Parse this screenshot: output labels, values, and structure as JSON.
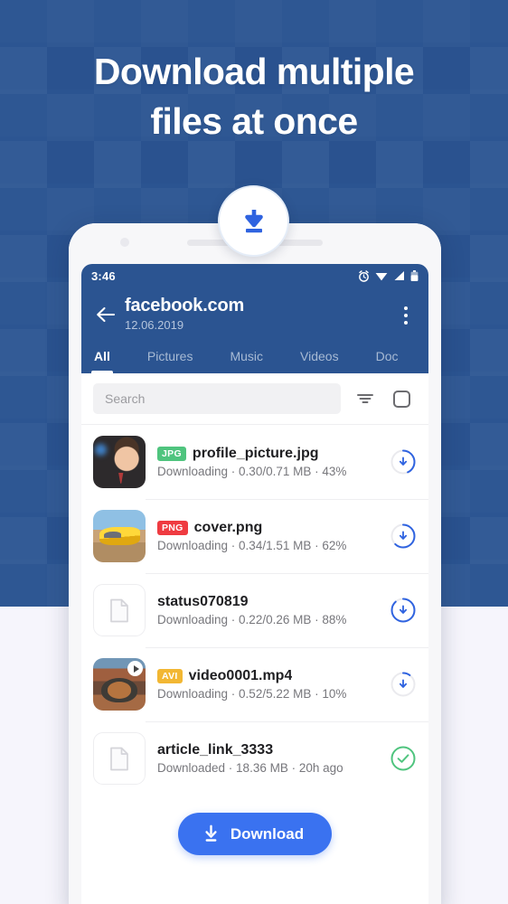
{
  "promo": {
    "headline_line1": "Download multiple",
    "headline_line2": "files at once",
    "medallion_icon": "download-arrow-icon",
    "bg_color": "#2b5491"
  },
  "phone": {
    "statusbar": {
      "time": "3:46",
      "icons": [
        "alarm-icon",
        "wifi-icon",
        "signal-icon",
        "battery-icon"
      ]
    },
    "appbar": {
      "back_icon": "back-arrow-icon",
      "title": "facebook.com",
      "subtitle": "12.06.2019",
      "overflow_icon": "more-vertical-icon"
    },
    "tabs": [
      {
        "label": "All",
        "active": true
      },
      {
        "label": "Pictures",
        "active": false
      },
      {
        "label": "Music",
        "active": false
      },
      {
        "label": "Videos",
        "active": false
      },
      {
        "label": "Doc",
        "active": false
      }
    ],
    "search": {
      "value": "",
      "placeholder": "Search",
      "sort_icon": "sort-filter-icon",
      "select_all_icon": "select-all-checkbox-icon"
    },
    "files": [
      {
        "name": "profile_picture.jpg",
        "badge": "JPG",
        "badge_color": "#4fc47e",
        "status": "Downloading · 0.30/0.71 MB · 43%",
        "state": "downloading",
        "percent": 43,
        "downloaded_mb": "0.30",
        "total_mb": "0.71",
        "thumb": "person-photo-thumb",
        "action_icon": "download-progress-icon"
      },
      {
        "name": "cover.png",
        "badge": "PNG",
        "badge_color": "#ef3b41",
        "status": "Downloading · 0.34/1.51 MB · 62%",
        "state": "downloading",
        "percent": 62,
        "downloaded_mb": "0.34",
        "total_mb": "1.51",
        "thumb": "car-photo-thumb",
        "action_icon": "download-progress-icon"
      },
      {
        "name": "status070819",
        "badge": "",
        "badge_color": "",
        "status": "Downloading · 0.22/0.26 MB · 88%",
        "state": "downloading",
        "percent": 88,
        "downloaded_mb": "0.22",
        "total_mb": "0.26",
        "thumb": "generic-document-thumb",
        "action_icon": "download-progress-icon"
      },
      {
        "name": "video0001.mp4",
        "badge": "AVI",
        "badge_color": "#f2b733",
        "status": "Downloading · 0.52/5.22 MB · 10%",
        "state": "downloading",
        "percent": 10,
        "downloaded_mb": "0.52",
        "total_mb": "5.22",
        "thumb": "video-photo-thumb",
        "action_icon": "download-progress-icon"
      },
      {
        "name": "article_link_3333",
        "badge": "",
        "badge_color": "",
        "status": "Downloaded · 18.36 MB · 20h ago",
        "state": "downloaded",
        "percent": 100,
        "size_mb": "18.36",
        "age": "20h ago",
        "thumb": "generic-document-thumb",
        "action_icon": "check-circle-icon"
      }
    ],
    "download_button": {
      "label": "Download",
      "icon": "download-icon",
      "color": "#3a72f0"
    }
  }
}
